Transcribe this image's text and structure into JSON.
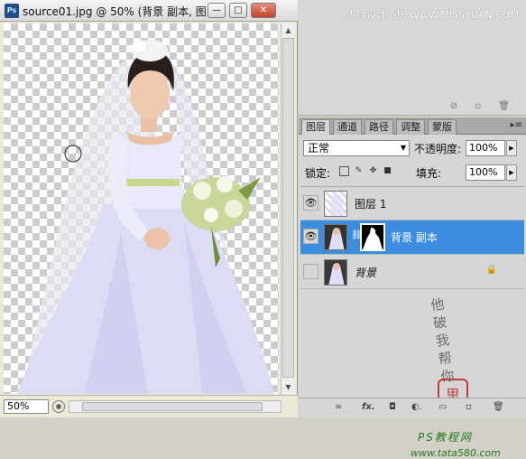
{
  "doc_window": {
    "title": "source01.jpg @ 50% (背景 副本, 图...",
    "ps_icon": "Ps",
    "minimize": "—",
    "maximize": "□",
    "close": "✕",
    "zoom": "50%"
  },
  "top_panel": {
    "watermark": "思缘设计论坛 WWW.MISSYUAN.COM"
  },
  "layers_panel": {
    "tabs": [
      "图层",
      "通道",
      "路径",
      "调整",
      "蒙版"
    ],
    "active_tab": "图层",
    "blend_mode": "正常",
    "opacity_label": "不透明度:",
    "opacity_value": "100%",
    "lock_label": "锁定:",
    "fill_label": "填充:",
    "fill_value": "100%",
    "layers": [
      {
        "name": "图层 1",
        "visible": true,
        "selected": false
      },
      {
        "name": "背景 副本",
        "visible": true,
        "selected": true,
        "has_mask": true
      },
      {
        "name": "背景",
        "visible": false,
        "selected": false,
        "locked": true
      }
    ],
    "watermark_lines": [
      "他",
      "破",
      "我",
      "帮",
      "你"
    ],
    "seal_text": "思",
    "watermark_bottom1": "PS教程网",
    "watermark_bottom2": "www.tata580.com"
  },
  "colors": {
    "selected_layer": "#3c8de0",
    "panel_bg": "#d6d6d6"
  }
}
